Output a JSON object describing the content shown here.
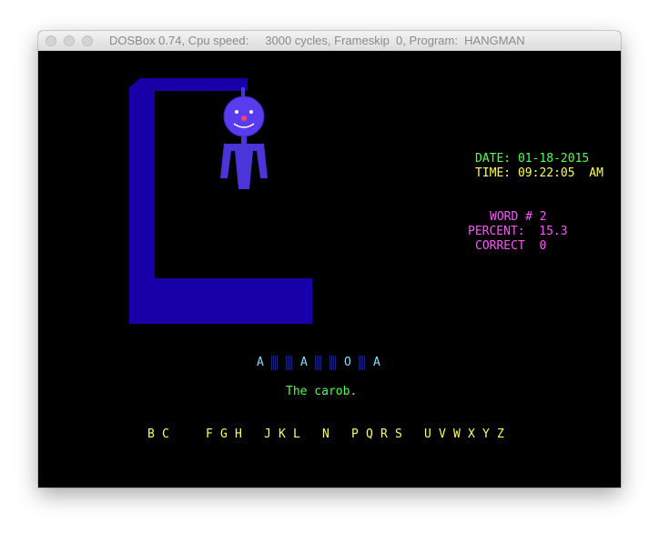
{
  "window": {
    "title": "DOSBox 0.74, Cpu speed:     3000 cycles, Frameskip  0, Program:  HANGMAN"
  },
  "status": {
    "date_label": "DATE:",
    "date_value": "01-18-2015",
    "time_label": "TIME:",
    "time_value": "09:22:05",
    "time_ampm": "AM",
    "word_label": "WORD #",
    "word_value": "2",
    "percent_label": "PERCENT:",
    "percent_value": "15.3",
    "correct_label": "CORRECT",
    "correct_value": "0"
  },
  "puzzle": {
    "letters": [
      "A",
      "",
      "",
      "A",
      "",
      "",
      "O",
      "",
      "A"
    ],
    "hint": "The carob."
  },
  "remaining_letters": [
    "B",
    "C",
    "",
    "",
    "F",
    "G",
    "H",
    "",
    "J",
    "K",
    "L",
    "",
    "N",
    "",
    "P",
    "Q",
    "R",
    "S",
    "",
    "U",
    "V",
    "W",
    "X",
    "Y",
    "Z"
  ],
  "colors": {
    "gallows": "#1800a8",
    "head": "#5a3cf0",
    "body": "#4a35d8",
    "date_time_label": "#55ff55",
    "date_time_value": "#ffff55",
    "stats": "#ff55ff",
    "hint": "#55ff55",
    "letters": "#ffff55",
    "word": "#88ddff"
  }
}
